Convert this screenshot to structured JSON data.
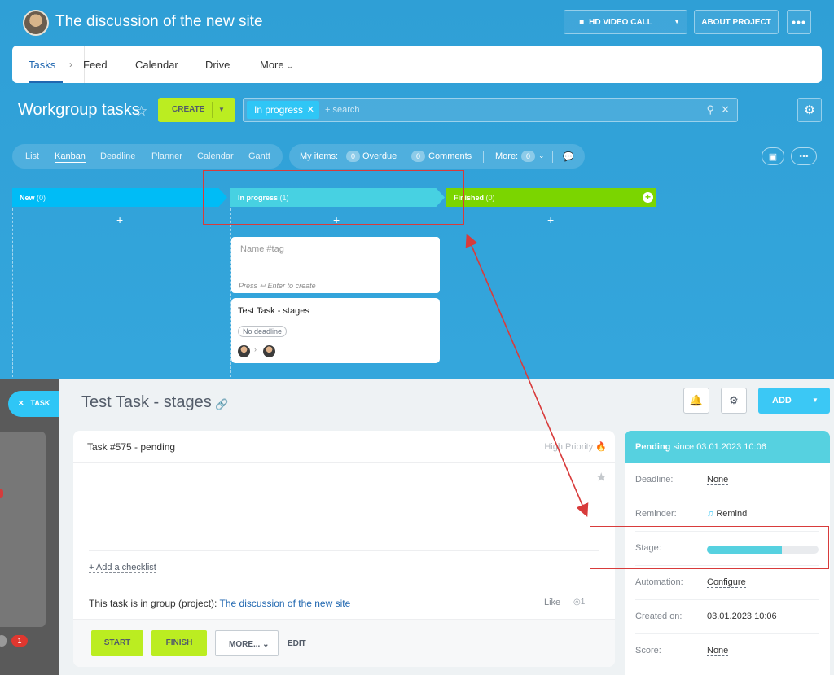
{
  "header": {
    "title": "The discussion of the new site",
    "video_call": "HD VIDEO CALL",
    "about": "ABOUT PROJECT",
    "more": "•••"
  },
  "tabs": [
    {
      "label": "Tasks",
      "active": true
    },
    {
      "label": "Feed"
    },
    {
      "label": "Calendar"
    },
    {
      "label": "Drive"
    },
    {
      "label": "More"
    }
  ],
  "toolbar": {
    "title": "Workgroup tasks",
    "create": "CREATE",
    "filter_chip": "In progress",
    "search_placeholder": "+ search"
  },
  "views": [
    "List",
    "Kanban",
    "Deadline",
    "Planner",
    "Calendar",
    "Gantt"
  ],
  "counters": {
    "my_items": "My items:",
    "overdue_count": "0",
    "overdue": "Overdue",
    "comments_count": "0",
    "comments": "Comments",
    "more": "More:",
    "more_count": "0"
  },
  "kanban": {
    "columns": [
      {
        "name": "New",
        "count": "(0)",
        "color": "#00bcf6"
      },
      {
        "name": "In progress",
        "count": "(1)",
        "color": "#47d1e2"
      },
      {
        "name": "Finished",
        "count": "(0)",
        "color": "#7bd500"
      }
    ],
    "add": "+",
    "new_card": {
      "placeholder": "Name #tag",
      "hint": "Press ↩ Enter to create"
    },
    "task_card": {
      "title": "Test Task - stages",
      "deadline": "No deadline"
    }
  },
  "panel": {
    "close_tab": "TASK",
    "title": "Test Task - stages",
    "add": "ADD",
    "task_header": "Task #575 - pending",
    "priority": "High Priority",
    "checklist": "+ Add a checklist",
    "group_text": "This task is in group (project):",
    "group_link": "The discussion of the new site",
    "like": "Like",
    "views_count": "1",
    "start": "START",
    "finish": "FINISH",
    "more": "MORE...",
    "edit": "EDIT",
    "left_badge": "1"
  },
  "sidebar": {
    "status": "Pending",
    "since": "since 03.01.2023 10:06",
    "rows": [
      {
        "label": "Deadline:",
        "value": "None"
      },
      {
        "label": "Reminder:",
        "value": "Remind"
      },
      {
        "label": "Stage:",
        "value": ""
      },
      {
        "label": "Automation:",
        "value": "Configure"
      },
      {
        "label": "Created on:",
        "value": "03.01.2023 10:06"
      },
      {
        "label": "Score:",
        "value": "None"
      }
    ],
    "stage_progress": 0.67
  }
}
